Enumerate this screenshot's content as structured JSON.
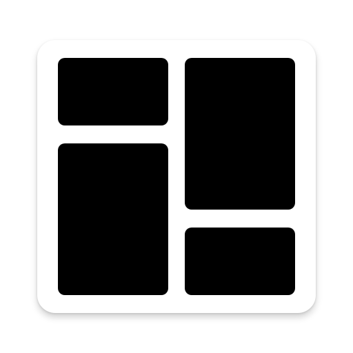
{
  "app_icon": {
    "icon_name": "dashboard-layout-icon",
    "colors": {
      "tile_background": "#ffffff",
      "panel_fill": "#000000"
    },
    "panels": [
      {
        "name": "panel-top-left"
      },
      {
        "name": "panel-bottom-left"
      },
      {
        "name": "panel-top-right"
      },
      {
        "name": "panel-bottom-right"
      }
    ]
  }
}
